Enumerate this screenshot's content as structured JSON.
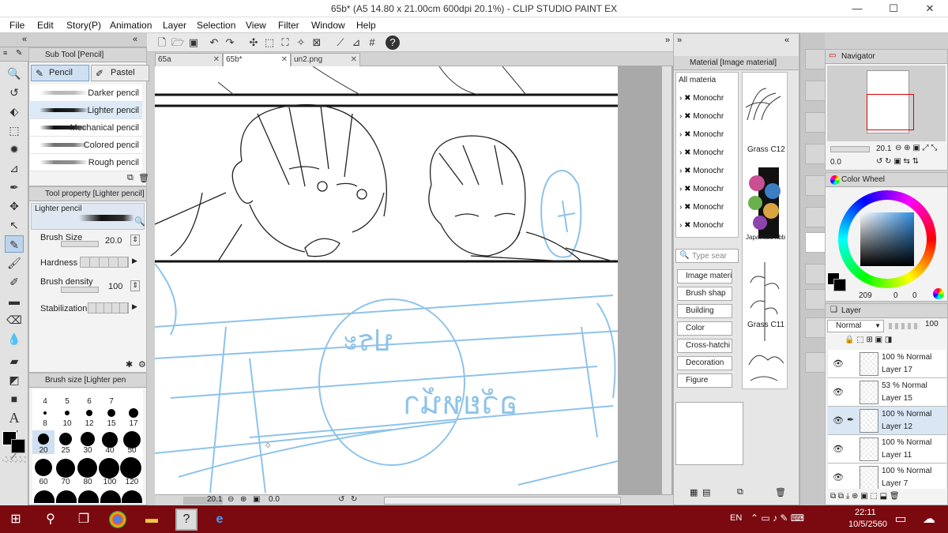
{
  "window": {
    "title": "65b* (A5 14.80 x 21.00cm 600dpi 20.1%) - CLIP STUDIO PAINT EX",
    "minimize": "—",
    "maximize": "☐",
    "close": "✕"
  },
  "menu": [
    "File",
    "Edit",
    "Story(P)",
    "Animation",
    "Layer",
    "Selection",
    "View",
    "Filter",
    "Window",
    "Help"
  ],
  "sub_tool": {
    "header": "Sub Tool [Pencil]",
    "tabs": [
      "Pencil",
      "Pastel"
    ],
    "items": [
      "Darker pencil",
      "Lighter pencil",
      "Mechanical pencil",
      "Colored pencil",
      "Rough pencil"
    ],
    "selected": "Lighter pencil"
  },
  "tool_property": {
    "header": "Tool property [Lighter pencil]",
    "preset_name": "Lighter pencil",
    "brush_size_label": "Brush Size",
    "brush_size_value": "20.0",
    "hardness_label": "Hardness",
    "brush_density_label": "Brush density",
    "brush_density_value": "100",
    "stabilization_label": "Stabilization"
  },
  "brush_size_panel": {
    "header": "Brush size [Lighter pen",
    "sizes_row1": [
      "4",
      "5",
      "6",
      "7"
    ],
    "sizes_row2": [
      "8",
      "10",
      "12",
      "15",
      "17"
    ],
    "sizes_row3": [
      "20",
      "25",
      "30",
      "40",
      "50"
    ],
    "sizes_row4": [
      "60",
      "70",
      "80",
      "100",
      "120"
    ],
    "selected": "20"
  },
  "tabs": [
    {
      "label": "65a",
      "close": "✕"
    },
    {
      "label": "65b*",
      "close": "✕"
    },
    {
      "label": "un2.png",
      "close": "✕"
    }
  ],
  "status": {
    "zoom": "20.1",
    "angle": "0.0"
  },
  "material": {
    "header": "Material [Image material]",
    "tree_root": "All materia",
    "tree_items": [
      "Monochr",
      "Monochr",
      "Monochr",
      "Monochr",
      "Monochr",
      "Monochr",
      "Monochr",
      "Monochr"
    ],
    "search_placeholder": "Type sear",
    "tags": [
      "Image materi",
      "Brush shap",
      "Building",
      "Color",
      "Cross-hatchi",
      "Decoration",
      "Figure"
    ],
    "thumbs": [
      "Grass C12",
      "Japanese ribb",
      "Grass C11"
    ]
  },
  "navigator": {
    "header": "Navigator",
    "zoom": "20.1",
    "angle": "0.0"
  },
  "color_wheel": {
    "header": "Color Wheel",
    "h_value": "209",
    "s_value": "0",
    "v_value": "0"
  },
  "layer": {
    "header": "Layer",
    "blend_mode": "Normal",
    "opacity": "100",
    "rows": [
      {
        "opacity": "100 %",
        "mode": "Normal",
        "name": "Layer 17"
      },
      {
        "opacity": "53 %",
        "mode": "Normal",
        "name": "Layer 15"
      },
      {
        "opacity": "100 %",
        "mode": "Normal",
        "name": "Layer 12"
      },
      {
        "opacity": "100 %",
        "mode": "Normal",
        "name": "Layer 11"
      },
      {
        "opacity": "100 %",
        "mode": "Normal",
        "name": "Layer 7"
      }
    ],
    "selected": "Layer 12"
  },
  "canvas_sketch_text": [
    "ประ",
    "อวัยหน้า"
  ],
  "taskbar": {
    "lang": "EN",
    "time": "22:11",
    "date": "10/5/2560"
  },
  "colors": {
    "taskbar": "#7a0a10",
    "sketch_blue": "#8ec3ea",
    "selection": "#dce9f6"
  }
}
